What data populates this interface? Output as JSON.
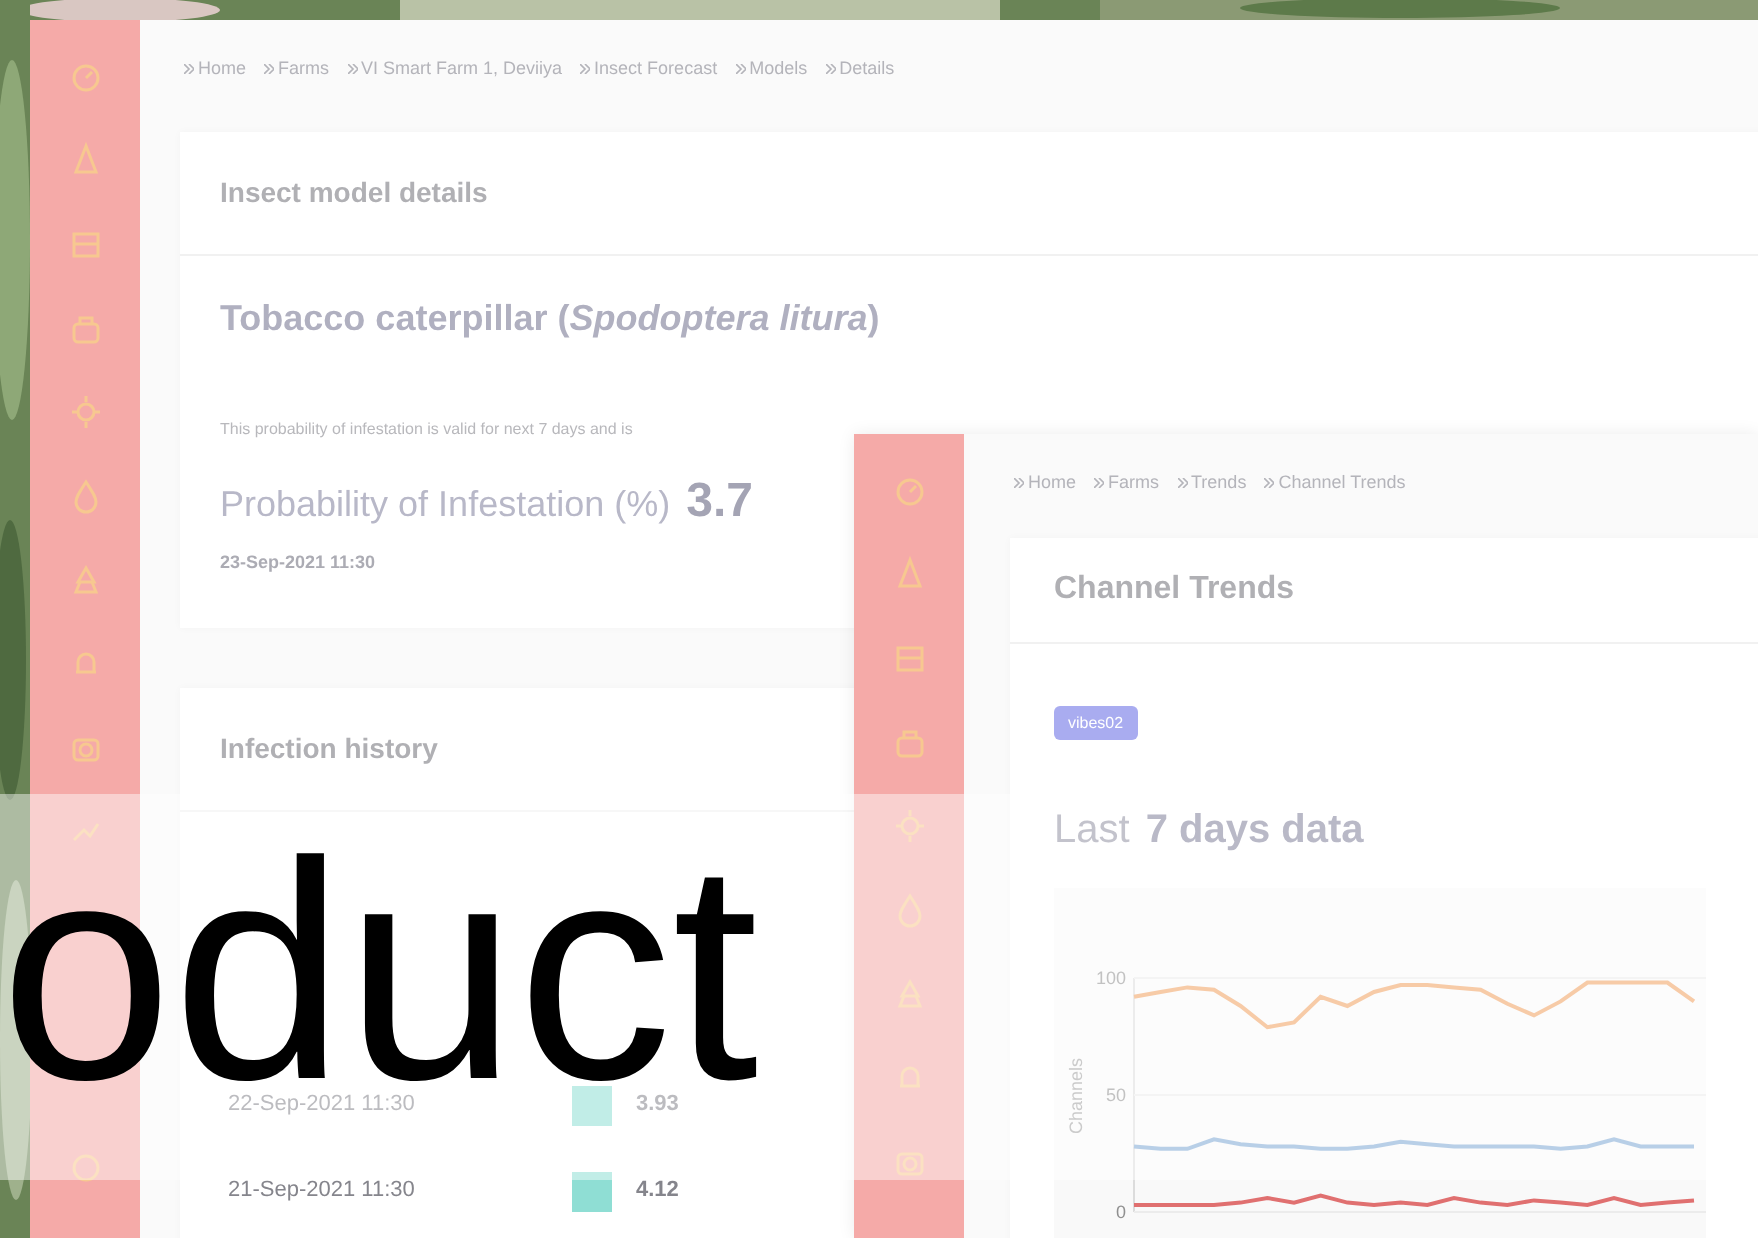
{
  "insect_screen": {
    "breadcrumb": [
      "Home",
      "Farms",
      "VI Smart Farm 1, Deviiya",
      "Insect Forecast",
      "Models",
      "Details"
    ],
    "details_card": {
      "header": "Insect model details",
      "insect_name": "Tobacco caterpillar (*Spodoptera litura*)",
      "note": "This probability of infestation is valid for next 7 days and is",
      "probability_label": "Probability of Infestation (%)",
      "probability_value": "3.7",
      "timestamp": "23-Sep-2021 11:30"
    },
    "history_card": {
      "header": "Infection history",
      "rows": [
        {
          "date": "22-Sep-2021 11:30",
          "value": "3.93"
        },
        {
          "date": "21-Sep-2021 11:30",
          "value": "4.12"
        }
      ]
    }
  },
  "trend_screen": {
    "breadcrumb": [
      "Home",
      "Farms",
      "Trends",
      "Channel Trends"
    ],
    "header": "Channel Trends",
    "badge": "vibes02",
    "title_muted": "Last",
    "title": "7 days data",
    "chart_data": {
      "type": "line",
      "ylabel": "Channels",
      "ylim": [
        0,
        100
      ],
      "yticks": [
        0,
        50,
        100
      ],
      "series": [
        {
          "color": "#f0a060",
          "values": [
            92,
            94,
            96,
            95,
            88,
            79,
            81,
            92,
            88,
            94,
            97,
            97,
            96,
            95,
            89,
            84,
            90,
            98,
            98,
            98,
            98,
            90
          ]
        },
        {
          "color": "#7fa8d4",
          "values": [
            28,
            27,
            27,
            31,
            29,
            28,
            28,
            27,
            27,
            28,
            30,
            29,
            28,
            28,
            28,
            28,
            27,
            28,
            31,
            28,
            28,
            28
          ]
        },
        {
          "color": "#e07070",
          "values": [
            3,
            3,
            3,
            3,
            4,
            6,
            4,
            7,
            4,
            3,
            4,
            3,
            6,
            4,
            3,
            5,
            4,
            3,
            6,
            3,
            4,
            5
          ]
        }
      ]
    }
  },
  "overlay": {
    "text": "oduct"
  }
}
